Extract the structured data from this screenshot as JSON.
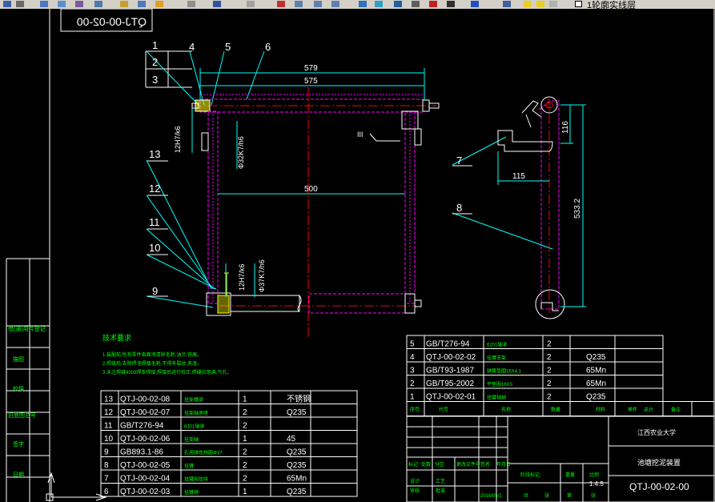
{
  "toolbar": {
    "layer_name": "1轮廓实线层",
    "icons": [
      "save-icon",
      "print-icon",
      "preview-icon",
      "publish-icon",
      "cut-icon",
      "copy-icon",
      "paste-icon",
      "matchprop-icon",
      "undo-icon",
      "redo-icon",
      "pan-icon",
      "zoom-realtime-icon",
      "zoom-window-icon",
      "zoom-previous-icon",
      "properties-icon",
      "designcenter-icon",
      "toolpalettes-icon",
      "sheetset-icon",
      "markup-icon",
      "calculator-icon",
      "help-icon",
      "layer-manager-icon",
      "layer-state-icons"
    ]
  },
  "drawing": {
    "number_mirrored": "QTJ-00-02-00",
    "balloons": [
      "1",
      "2",
      "3",
      "4",
      "5",
      "6",
      "7",
      "8",
      "9",
      "10",
      "11",
      "12",
      "13"
    ],
    "dims": {
      "d579": "579",
      "d575": "575",
      "d500": "500",
      "d115": "115",
      "d116": "116",
      "d533": "533.2",
      "fit_12h7": "12H7/k6",
      "fit_32k7": "Φ32K7/h6",
      "fit_12h7b": "12H7/k6",
      "fit_37k7": "Φ37K7/h6",
      "mark_iii": "III"
    },
    "tech_req": {
      "title": "技术要求",
      "lines": [
        "1.装配前,所有零件表面须清除毛刺,油污,铁屑。",
        "2.焊接后,去除焊渣焊瘤毛刺,不得有裂纹,夹渣。",
        "3.未注焊缝4303焊条焊接,焊接后进行校正,焊缝应饱满,气孔。"
      ]
    },
    "parts_left": [
      [
        "13",
        "QTJ-00-02-08",
        "挂架横梁",
        "1",
        "不锈钢"
      ],
      [
        "12",
        "QTJ-00-02-07",
        "挂架轴承座",
        "2",
        "Q235"
      ],
      [
        "11",
        "GB/T276-94",
        "6301轴承",
        "2",
        ""
      ],
      [
        "10",
        "QTJ-00-02-06",
        "挂架轴",
        "1",
        "45"
      ],
      [
        "9",
        "GB893.1-86",
        "孔用弹性挡圈Φ37",
        "2",
        "Q235"
      ],
      [
        "8",
        "QTJ-00-02-05",
        "挂臂",
        "2",
        "Q235"
      ],
      [
        "7",
        "QTJ-00-02-04",
        "挂臂钩挂块",
        "2",
        "65Mn"
      ],
      [
        "6",
        "QTJ-00-02-03",
        "挂臂销",
        "1",
        "Q235"
      ]
    ],
    "parts_right": [
      [
        "5",
        "GB/T276-94",
        "6201轴承",
        "2",
        ""
      ],
      [
        "4",
        "QTJ-00-02-02",
        "挂臂支架",
        "2",
        "Q235"
      ],
      [
        "3",
        "GB/T93-1987",
        "弹簧垫圈16X4.1",
        "2",
        "65Mn"
      ],
      [
        "2",
        "GB/T95-2002",
        "平垫圈16X3",
        "2",
        "65Mn"
      ],
      [
        "1",
        "QTJ-00-02-01",
        "挂臂轴销",
        "2",
        "Q235"
      ]
    ],
    "parts_header": [
      "序号",
      "代号",
      "名称",
      "数量",
      "材料",
      "单件",
      "总计",
      "备注",
      "重量"
    ],
    "title_block": {
      "school": "江西农业大学",
      "drawing_title": "池塘挖泥装置",
      "drawing_number": "QTJ-00-02-00",
      "scale": "1:4.5",
      "sheet_labels": [
        "阶段标记",
        "重量",
        "比例",
        "共",
        "张",
        "第",
        "张"
      ],
      "rev_labels": [
        "标记",
        "处数",
        "分区",
        "更改文件号",
        "签名",
        "年月日"
      ],
      "person_labels": [
        "设计",
        "审核",
        "工艺",
        "批准"
      ],
      "date": "2016/05/1"
    },
    "side_labels": [
      "借(通)用件登记",
      "描图",
      "校描",
      "旧底图总号",
      "签字",
      "日期"
    ]
  }
}
